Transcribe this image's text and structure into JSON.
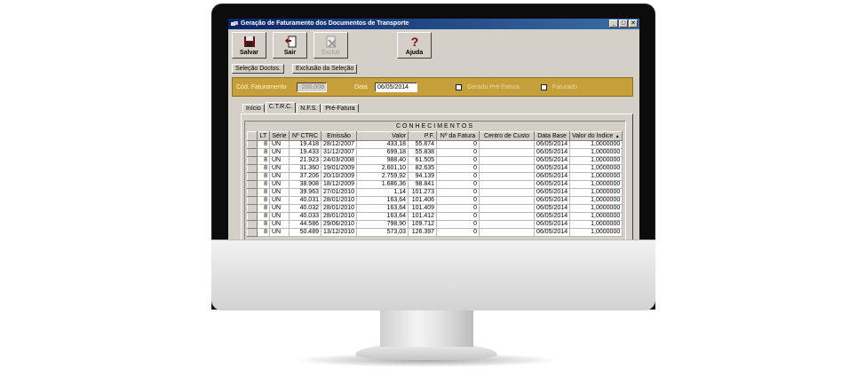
{
  "window": {
    "title": "Geração de Faturamento dos Documentos de Transporte",
    "controls": [
      "_",
      "□",
      "✕"
    ]
  },
  "toolbar": {
    "save_label": "Salvar",
    "exit_label": "Sair",
    "delete_label": "Excluir",
    "help_label": "Ajuda"
  },
  "actions": {
    "select_docs_label": "Seleção Doctos.",
    "exclude_selection_label": "Exclusão da Seleção"
  },
  "filters": {
    "billing_code_label": "Cód. Faturamento",
    "billing_code_value": "200.008",
    "date_label": "Data",
    "date_value": "06/05/2014",
    "pre_invoice_label": "Gerado Pré-Fatura",
    "billed_label": "Faturado",
    "bar_color": "#c5a03a"
  },
  "tabs": [
    "Início",
    "C.T.R.C.",
    "N.F.S.",
    "Pré-Fatura"
  ],
  "active_tab": "C.T.R.C.",
  "grid": {
    "title": "CONHECIMENTOS",
    "columns": [
      "LT",
      "Série",
      "Nº CTRC",
      "Emissão",
      "Valor",
      "P.F.",
      "Nº da Fatura",
      "Centro de Custo",
      "Data Base",
      "Valor do Índice"
    ],
    "rows": [
      [
        "8",
        "UN",
        "19.418",
        "28/12/2007",
        "433,18",
        "55.874",
        "0",
        "",
        "06/05/2014",
        "1,0000000"
      ],
      [
        "8",
        "UN",
        "19.433",
        "31/12/2007",
        "699,18",
        "55.838",
        "0",
        "",
        "06/05/2014",
        "1,0000000"
      ],
      [
        "8",
        "UN",
        "21.923",
        "24/03/2008",
        "988,40",
        "61.505",
        "0",
        "",
        "06/05/2014",
        "1,0000000"
      ],
      [
        "8",
        "UN",
        "31.360",
        "19/01/2009",
        "2.601,10",
        "82.635",
        "0",
        "",
        "06/05/2014",
        "1,0000000"
      ],
      [
        "8",
        "UN",
        "37.206",
        "20/10/2009",
        "2.759,92",
        "94.139",
        "0",
        "",
        "06/05/2014",
        "1,0000000"
      ],
      [
        "8",
        "UN",
        "38.908",
        "18/12/2009",
        "1.686,36",
        "98.841",
        "0",
        "",
        "06/05/2014",
        "1,0000000"
      ],
      [
        "8",
        "UN",
        "39.963",
        "27/01/2010",
        "1,14",
        "101.273",
        "0",
        "",
        "06/05/2014",
        "1,0000000"
      ],
      [
        "8",
        "UN",
        "40.031",
        "28/01/2010",
        "163,64",
        "101.406",
        "0",
        "",
        "06/05/2014",
        "1,0000000"
      ],
      [
        "8",
        "UN",
        "40.032",
        "28/01/2010",
        "163,64",
        "101.409",
        "0",
        "",
        "06/05/2014",
        "1,0000000"
      ],
      [
        "8",
        "UN",
        "40.033",
        "28/01/2010",
        "163,64",
        "101.412",
        "0",
        "",
        "06/05/2014",
        "1,0000000"
      ],
      [
        "8",
        "UN",
        "44.586",
        "29/06/2010",
        "798,90",
        "109.712",
        "0",
        "",
        "06/05/2014",
        "1,0000000"
      ],
      [
        "8",
        "UN",
        "50.489",
        "13/12/2010",
        "573,03",
        "126.397",
        "0",
        "",
        "06/05/2014",
        "1,0000000"
      ]
    ]
  }
}
